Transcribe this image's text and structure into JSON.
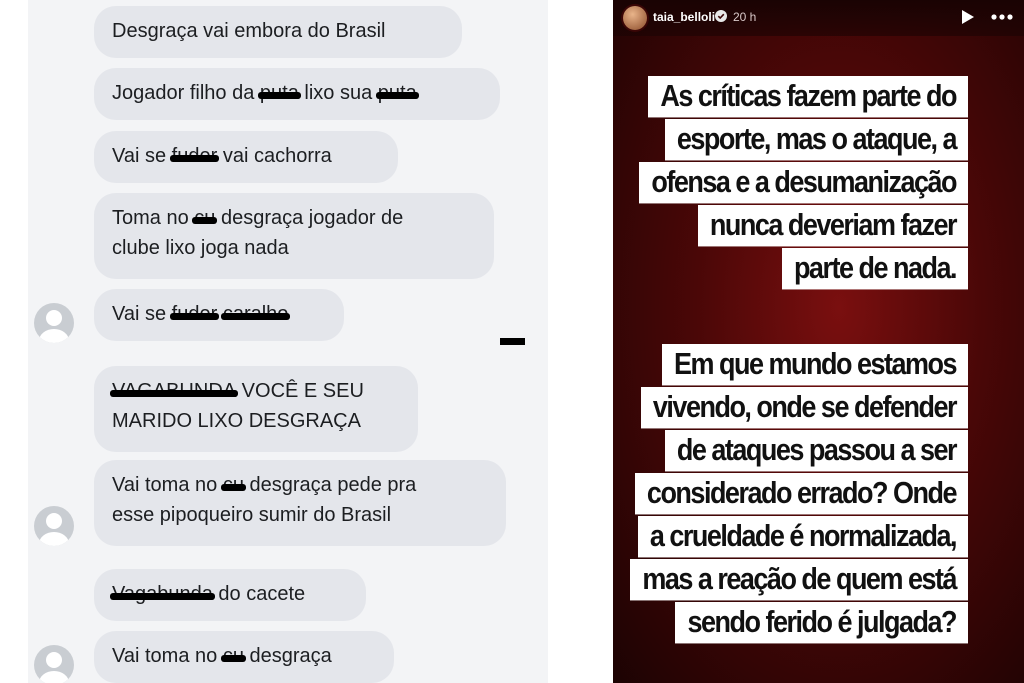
{
  "left": {
    "messages": [
      {
        "parts": [
          {
            "t": "Desgraça vai embora do Brasil"
          }
        ]
      },
      {
        "parts": [
          {
            "t": "Jogador filho da "
          },
          {
            "t": "puta",
            "c": true
          },
          {
            "t": " lixo sua "
          },
          {
            "t": "puta",
            "c": true
          }
        ]
      },
      {
        "parts": [
          {
            "t": "Vai se "
          },
          {
            "t": "fuder",
            "c": true
          },
          {
            "t": " vai cachorra"
          }
        ]
      },
      {
        "parts": [
          {
            "t": "Toma no "
          },
          {
            "t": "cu",
            "c": true
          },
          {
            "t": " desgraça jogador de"
          }
        ],
        "parts2": [
          {
            "t": "clube lixo joga nada"
          }
        ]
      },
      {
        "parts": [
          {
            "t": "Vai se "
          },
          {
            "t": "fuder",
            "c": true
          },
          {
            "t": " "
          },
          {
            "t": "caralho",
            "c": true
          }
        ]
      },
      {
        "parts": [
          {
            "t": "VAGABUNDA",
            "c": true
          },
          {
            "t": " VOCÊ E SEU"
          }
        ],
        "parts2": [
          {
            "t": "MARIDO LIXO DESGRAÇA"
          }
        ]
      },
      {
        "parts": [
          {
            "t": "Vai toma no "
          },
          {
            "t": "cu",
            "c": true
          },
          {
            "t": " desgraça pede pra"
          }
        ],
        "parts2": [
          {
            "t": "esse pipoqueiro sumir do Brasil"
          }
        ]
      },
      {
        "parts": [
          {
            "t": "Vagabunda",
            "c": true
          },
          {
            "t": " do cacete"
          }
        ]
      },
      {
        "parts": [
          {
            "t": "Vai toma no "
          },
          {
            "t": "cu",
            "c": true
          },
          {
            "t": " desgraça"
          }
        ]
      }
    ]
  },
  "story": {
    "username": "taia_belloli",
    "time": "20 h",
    "icons": {
      "avatar": "profile-photo",
      "verified": "verified-badge-icon",
      "play": "play-icon",
      "more": "more-icon"
    },
    "block1": [
      "As críticas fazem parte do",
      "esporte, mas o ataque, a",
      "ofensa e a desumanização",
      "nunca deveriam fazer",
      "parte de nada."
    ],
    "block2": [
      "Em que mundo estamos",
      "vivendo, onde se defender",
      "de ataques passou a ser",
      "considerado errado? Onde",
      "a crueldade é normalizada,",
      "mas a reação de quem está",
      "sendo ferido é julgada?"
    ]
  },
  "colors": {
    "bubble": "#e4e6eb",
    "story_bg": "#5a0909",
    "text_box": "#ffffff"
  }
}
